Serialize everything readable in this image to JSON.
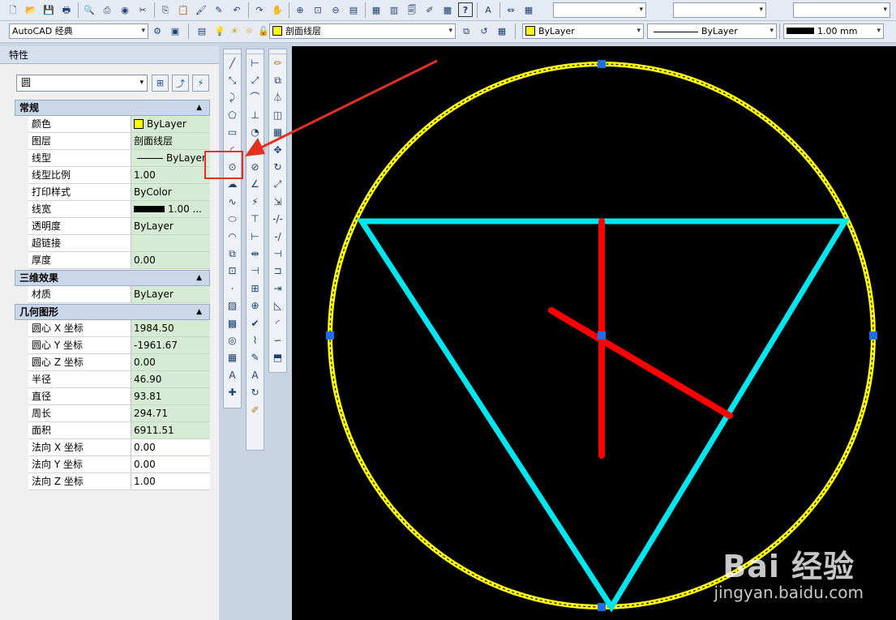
{
  "colors": {
    "circle": "#ffff00",
    "triangle": "#00e5ee",
    "center_lines": "#ff0000",
    "grip": "#1e6fe6",
    "annotation": "#e23121",
    "canvas_bg": "#000000"
  },
  "toolbar1": {
    "icons": [
      "new-icon",
      "open-icon",
      "save-icon",
      "plot-icon",
      "plot-preview-icon",
      "publish-icon",
      "3d-dwf-icon",
      "cut-icon",
      "copy-icon",
      "paste-icon",
      "match-properties-icon",
      "block-editor-icon",
      "undo-icon",
      "redo-icon",
      "pan-icon",
      "zoom-realtime-icon",
      "zoom-window-icon",
      "zoom-previous-icon",
      "properties-icon",
      "design-center-icon",
      "tool-palettes-icon",
      "sheet-set-icon",
      "markup-icon",
      "calculator-icon",
      "help-icon",
      "text-style-icon",
      "dim-style-icon",
      "table-style-icon"
    ]
  },
  "toolbar2": {
    "workspace": "AutoCAD 经典",
    "layer": "剖面线层",
    "color": "ByLayer",
    "linetype": "ByLayer",
    "lineweight": "1.00 mm"
  },
  "properties": {
    "title": "特性",
    "object_type": "圆",
    "sections": [
      {
        "title": "常规",
        "rows": [
          {
            "name": "颜色",
            "value": "ByLayer",
            "kind": "color"
          },
          {
            "name": "图层",
            "value": "剖面线层"
          },
          {
            "name": "线型",
            "value": "ByLayer",
            "kind": "linetype"
          },
          {
            "name": "线型比例",
            "value": "1.00"
          },
          {
            "name": "打印样式",
            "value": "ByColor"
          },
          {
            "name": "线宽",
            "value": "1.00 ...",
            "kind": "lineweight"
          },
          {
            "name": "透明度",
            "value": "ByLayer"
          },
          {
            "name": "超链接",
            "value": ""
          },
          {
            "name": "厚度",
            "value": "0.00"
          }
        ]
      },
      {
        "title": "三维效果",
        "rows": [
          {
            "name": "材质",
            "value": "ByLayer"
          }
        ]
      },
      {
        "title": "几何图形",
        "rows": [
          {
            "name": "圆心 X 坐标",
            "value": "1984.50"
          },
          {
            "name": "圆心 Y 坐标",
            "value": "-1961.67"
          },
          {
            "name": "圆心 Z 坐标",
            "value": "0.00"
          },
          {
            "name": "半径",
            "value": "46.90"
          },
          {
            "name": "直径",
            "value": "93.81"
          },
          {
            "name": "周长",
            "value": "294.71"
          },
          {
            "name": "面积",
            "value": "6911.51"
          },
          {
            "name": "法向 X 坐标",
            "value": "0.00",
            "white": true
          },
          {
            "name": "法向 Y 坐标",
            "value": "0.00",
            "white": true
          },
          {
            "name": "法向 Z 坐标",
            "value": "1.00",
            "white": true
          }
        ]
      }
    ]
  },
  "draw_toolbar": [
    "line-icon",
    "construction-line-icon",
    "polyline-icon",
    "polygon-icon",
    "rectangle-icon",
    "arc-icon",
    "circle-icon",
    "revision-cloud-icon",
    "spline-icon",
    "ellipse-icon",
    "ellipse-arc-icon",
    "insert-block-icon",
    "make-block-icon",
    "point-icon",
    "hatch-icon",
    "gradient-icon",
    "region-icon",
    "table-icon",
    "multiline-text-icon",
    "add-selected-icon"
  ],
  "dim_toolbar": [
    "linear-dim-icon",
    "aligned-dim-icon",
    "arc-length-icon",
    "ordinate-dim-icon",
    "radius-dim-icon",
    "jogged-dim-icon",
    "diameter-dim-icon",
    "angular-dim-icon",
    "quick-dim-icon",
    "baseline-dim-icon",
    "continue-dim-icon",
    "dim-space-icon",
    "dim-break-icon",
    "tolerance-icon",
    "center-mark-icon",
    "inspection-icon",
    "jogged-linear-icon",
    "dim-edit-icon",
    "dim-text-edit-icon",
    "dim-update-icon",
    "dim-style-icon"
  ],
  "modify_toolbar": [
    "erase-icon",
    "copy-object-icon",
    "mirror-icon",
    "offset-icon",
    "array-icon",
    "move-icon",
    "rotate-icon",
    "scale-icon",
    "stretch-icon",
    "trim-icon",
    "extend-icon",
    "break-at-point-icon",
    "break-icon",
    "join-icon",
    "chamfer-icon",
    "fillet-icon",
    "blend-curves-icon",
    "explode-icon"
  ],
  "watermark": {
    "brand": "Bai 经验",
    "url": "jingyan.baidu.com"
  }
}
